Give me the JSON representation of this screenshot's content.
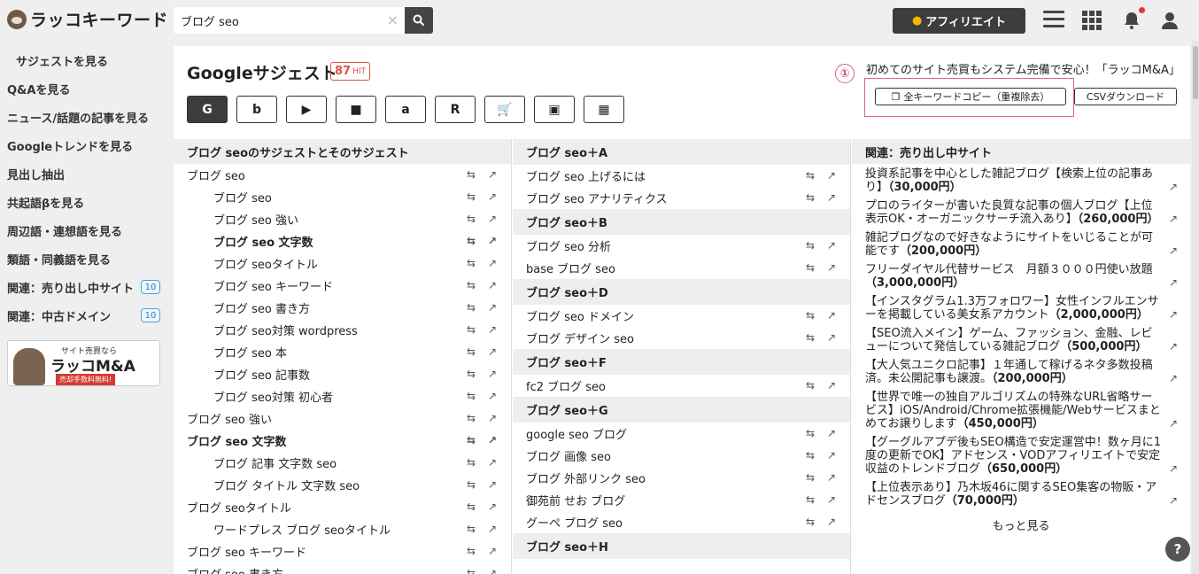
{
  "header": {
    "logo_text": "ラッコキーワード",
    "search_value": "ブログ seo",
    "affiliate_label": "アフィリエイト"
  },
  "sidebar": {
    "items": [
      {
        "label": "サジェストを見る"
      },
      {
        "label": "Q&Aを見る"
      },
      {
        "label": "ニュース/話題の記事を見る"
      },
      {
        "label": "Googleトレンドを見る"
      },
      {
        "label": "見出し抽出"
      },
      {
        "label": "共起語βを見る"
      },
      {
        "label": "周辺語・連想語を見る"
      },
      {
        "label": "類語・同義語を見る"
      },
      {
        "label": "関連：売り出し中サイト",
        "badge": "10"
      },
      {
        "label": "関連：中古ドメイン",
        "badge": "10"
      }
    ],
    "banner": {
      "small": "サイト売買なら",
      "big": "ラッコM&A",
      "red": "売却手数料無料!"
    }
  },
  "main": {
    "title": "Googleサジェスト",
    "hit_count": "87",
    "hit_label": "HIT",
    "engines": [
      "G",
      "b",
      "▶",
      "■",
      "a",
      "R",
      "🛒",
      "▣",
      "▦"
    ],
    "promo": "初めてのサイト売買もシステム完備で安心！「ラッコM&A」",
    "step_number": "①",
    "copy_label": "全キーワードコピー（重複除去）",
    "csv_label": "CSVダウンロード"
  },
  "col1": {
    "header": "ブログ seoのサジェストとそのサジェスト",
    "rows": [
      {
        "text": "ブログ seo",
        "lvl": 0,
        "bold": false
      },
      {
        "text": "ブログ seo",
        "lvl": 1,
        "bold": false
      },
      {
        "text": "ブログ seo 強い",
        "lvl": 1,
        "bold": false
      },
      {
        "text": "ブログ seo 文字数",
        "lvl": 1,
        "bold": true
      },
      {
        "text": "ブログ seoタイトル",
        "lvl": 1,
        "bold": false
      },
      {
        "text": "ブログ seo キーワード",
        "lvl": 1,
        "bold": false
      },
      {
        "text": "ブログ seo 書き方",
        "lvl": 1,
        "bold": false
      },
      {
        "text": "ブログ seo対策 wordpress",
        "lvl": 1,
        "bold": false
      },
      {
        "text": "ブログ seo 本",
        "lvl": 1,
        "bold": false
      },
      {
        "text": "ブログ seo 記事数",
        "lvl": 1,
        "bold": false
      },
      {
        "text": "ブログ seo対策 初心者",
        "lvl": 1,
        "bold": false
      },
      {
        "text": "ブログ seo 強い",
        "lvl": 0,
        "bold": false
      },
      {
        "text": "ブログ seo 文字数",
        "lvl": 0,
        "bold": true
      },
      {
        "text": "ブログ 記事 文字数 seo",
        "lvl": 1,
        "bold": false
      },
      {
        "text": "ブログ タイトル 文字数 seo",
        "lvl": 1,
        "bold": false
      },
      {
        "text": "ブログ seoタイトル",
        "lvl": 0,
        "bold": false
      },
      {
        "text": "ワードプレス ブログ seoタイトル",
        "lvl": 1,
        "bold": false
      },
      {
        "text": "ブログ seo キーワード",
        "lvl": 0,
        "bold": false
      },
      {
        "text": "ブログ seo 書き方",
        "lvl": 0,
        "bold": false
      }
    ]
  },
  "col2": {
    "sections": [
      {
        "head": "ブログ seo＋A",
        "rows": [
          "ブログ seo 上げるには",
          "ブログ seo アナリティクス"
        ]
      },
      {
        "head": "ブログ seo＋B",
        "rows": [
          "ブログ seo 分析",
          "base ブログ seo"
        ]
      },
      {
        "head": "ブログ seo＋D",
        "rows": [
          "ブログ seo ドメイン",
          "ブログ デザイン seo"
        ]
      },
      {
        "head": "ブログ seo＋F",
        "rows": [
          "fc2 ブログ seo"
        ]
      },
      {
        "head": "ブログ seo＋G",
        "rows": [
          "google seo ブログ",
          "ブログ 画像 seo",
          "ブログ 外部リンク seo",
          "御苑前 せお ブログ",
          "グーペ ブログ seo"
        ]
      },
      {
        "head": "ブログ seo＋H",
        "rows": []
      }
    ]
  },
  "col3": {
    "header": "関連：売り出し中サイト",
    "items": [
      {
        "text": "投資系記事を中心とした雑記ブログ【検索上位の記事あり】",
        "price": "（30,000円）"
      },
      {
        "text": "プロのライターが書いた良質な記事の個人ブログ【上位表示OK・オーガニックサーチ流入あり】",
        "price": "（260,000円）"
      },
      {
        "text": "雑記ブログなので好きなようにサイトをいじることが可能です",
        "price": "（200,000円）"
      },
      {
        "text": "フリーダイヤル代替サービス　月額３０００円使い放題",
        "price": "（3,000,000円）"
      },
      {
        "text": "【インスタグラム1.3万フォロワー】女性インフルエンサーを掲載している美女系アカウント",
        "price": "（2,000,000円）"
      },
      {
        "text": "【SEO流入メイン】ゲーム、ファッション、金融、レビューについて発信している雑記ブログ",
        "price": "（500,000円）"
      },
      {
        "text": "【大人気ユニクロ記事】１年通して稼げるネタ多数投稿済。未公開記事も譲渡。",
        "price": "（200,000円）"
      },
      {
        "text": "【世界で唯一の独自アルゴリズムの特殊なURL省略サービス】iOS/Android/Chrome拡張機能/Webサービスまとめてお譲りします",
        "price": "（450,000円）"
      },
      {
        "text": "【グーグルアプデ後もSEO構造で安定運営中！数ヶ月に1度の更新でOK】アドセンス・VODアフィリエイトで安定収益のトレンドブログ",
        "price": "（650,000円）"
      },
      {
        "text": "【上位表示あり】乃木坂46に関するSEO集客の物販・アドセンスブログ",
        "price": "（70,000円）"
      }
    ],
    "more_label": "もっと見る"
  },
  "help_label": "?"
}
